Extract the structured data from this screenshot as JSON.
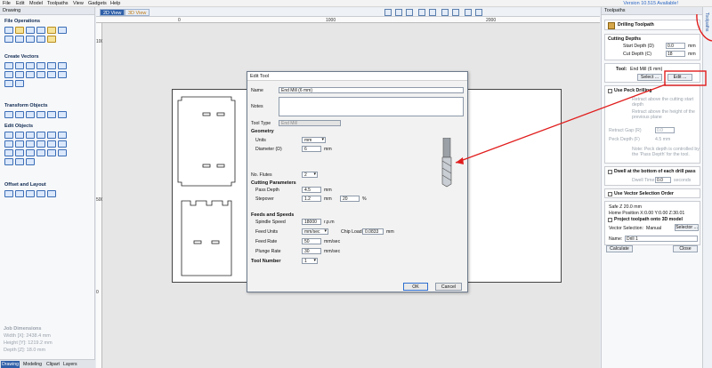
{
  "menubar": {
    "items": [
      "File",
      "Edit",
      "Model",
      "Toolpaths",
      "View",
      "Gadgets",
      "Help"
    ],
    "update_note": "Version 10.515 Available!"
  },
  "left_panel": {
    "title": "Drawing",
    "sections": {
      "file_ops": "File Operations",
      "create_vectors": "Create Vectors",
      "transform_objects": "Transform Objects",
      "edit_objects": "Edit Objects",
      "offset_layout": "Offset and Layout"
    },
    "job_dimensions": {
      "heading": "Job Dimensions",
      "width": "Width  [X]: 2438.4 mm",
      "height": "Height [Y]: 1219.2 mm",
      "depth": "Depth  [Z]: 18.0 mm"
    },
    "tabs": [
      "Drawing",
      "Modeling",
      "Clipart",
      "Layers"
    ]
  },
  "viewbar": {
    "tab_2d": "2D View",
    "tab_3d": "3D View"
  },
  "rulers": {
    "top": [
      "0",
      "1000",
      "2000"
    ],
    "left": [
      "1000",
      "500",
      "0"
    ]
  },
  "dialog": {
    "title": "Edit Tool",
    "name_label": "Name",
    "name_value": "End Mill (6 mm)",
    "notes_label": "Notes",
    "notes_value": "",
    "tool_type_label": "Tool Type",
    "tool_type_value": "End Mill",
    "geometry_head": "Geometry",
    "units_label": "Units",
    "units_value": "mm",
    "diameter_label": "Diameter (D)",
    "diameter_value": "6",
    "diameter_unit": "mm",
    "flutes_label": "No. Flutes",
    "flutes_value": "2",
    "cutting_head": "Cutting Parameters",
    "pass_depth_label": "Pass Depth",
    "pass_depth_value": "4.5",
    "pass_depth_unit": "mm",
    "stepover_label": "Stepover",
    "stepover_value": "1.2",
    "stepover_unit": "mm",
    "stepover_pct": "20",
    "pct_sign": "%",
    "feeds_head": "Feeds and Speeds",
    "spindle_label": "Spindle Speed",
    "spindle_value": "18000",
    "spindle_unit": "r.p.m",
    "feed_units_label": "Feed Units",
    "feed_units_value": "mm/sec",
    "chip_load_label": "Chip Load",
    "chip_load_value": "0.0833",
    "chip_load_unit": "mm",
    "feed_rate_label": "Feed Rate",
    "feed_rate_value": "50",
    "feed_rate_unit": "mm/sec",
    "plunge_label": "Plunge Rate",
    "plunge_value": "30",
    "plunge_unit": "mm/sec",
    "tool_number_label": "Tool Number",
    "tool_number_value": "1",
    "ok": "OK",
    "cancel": "Cancel"
  },
  "right_panel": {
    "title": "Toolpaths",
    "header": "Drilling Toolpath",
    "cutting_depths": "Cutting Depths",
    "start_depth_label": "Start Depth (D)",
    "start_depth_value": "0.0",
    "cut_depth_label": "Cut Depth (C)",
    "cut_depth_value": "18",
    "unit": "mm",
    "tool_label": "Tool:",
    "tool_value": "End Mill (6 mm)",
    "select_btn": "Select ...",
    "edit_btn": "Edit ...",
    "peck_label": "Use Peck Drilling",
    "peck_opt1": "Retract above the cutting start depth",
    "peck_opt2": "Retract above the height of the previous plane",
    "retract_gap_label": "Retract Gap (R)",
    "retract_gap_value": "0.0",
    "peck_depth_label": "Peck Depth (F)",
    "peck_depth_value": "4.5 mm",
    "peck_note": "Note: Peck depth is controlled by the 'Pass Depth' for the tool.",
    "dwell_label": "Dwell at the bottom of each drill pass",
    "dwell_time_label": "Dwell Time",
    "dwell_time_value": "0.0",
    "dwell_unit": "seconds",
    "vector_sel_label": "Use Vector Selection Order",
    "safe_z": "Safe Z          20.0 mm",
    "home": "Home Position  X:0.00 Y:0.00 Z:30.01",
    "project_label": "Project toolpath onto 3D model",
    "vector_selection_label": "Vector Selection:",
    "vector_selection_value": "Manual",
    "selector_btn": "Selector ...",
    "name_label": "Name:",
    "name_value": "Drill 1",
    "calculate": "Calculate",
    "close": "Close",
    "side_tab": "Toolpaths"
  },
  "colors": {
    "accent": "#2f5fa8",
    "annotation": "#e11d1d"
  }
}
